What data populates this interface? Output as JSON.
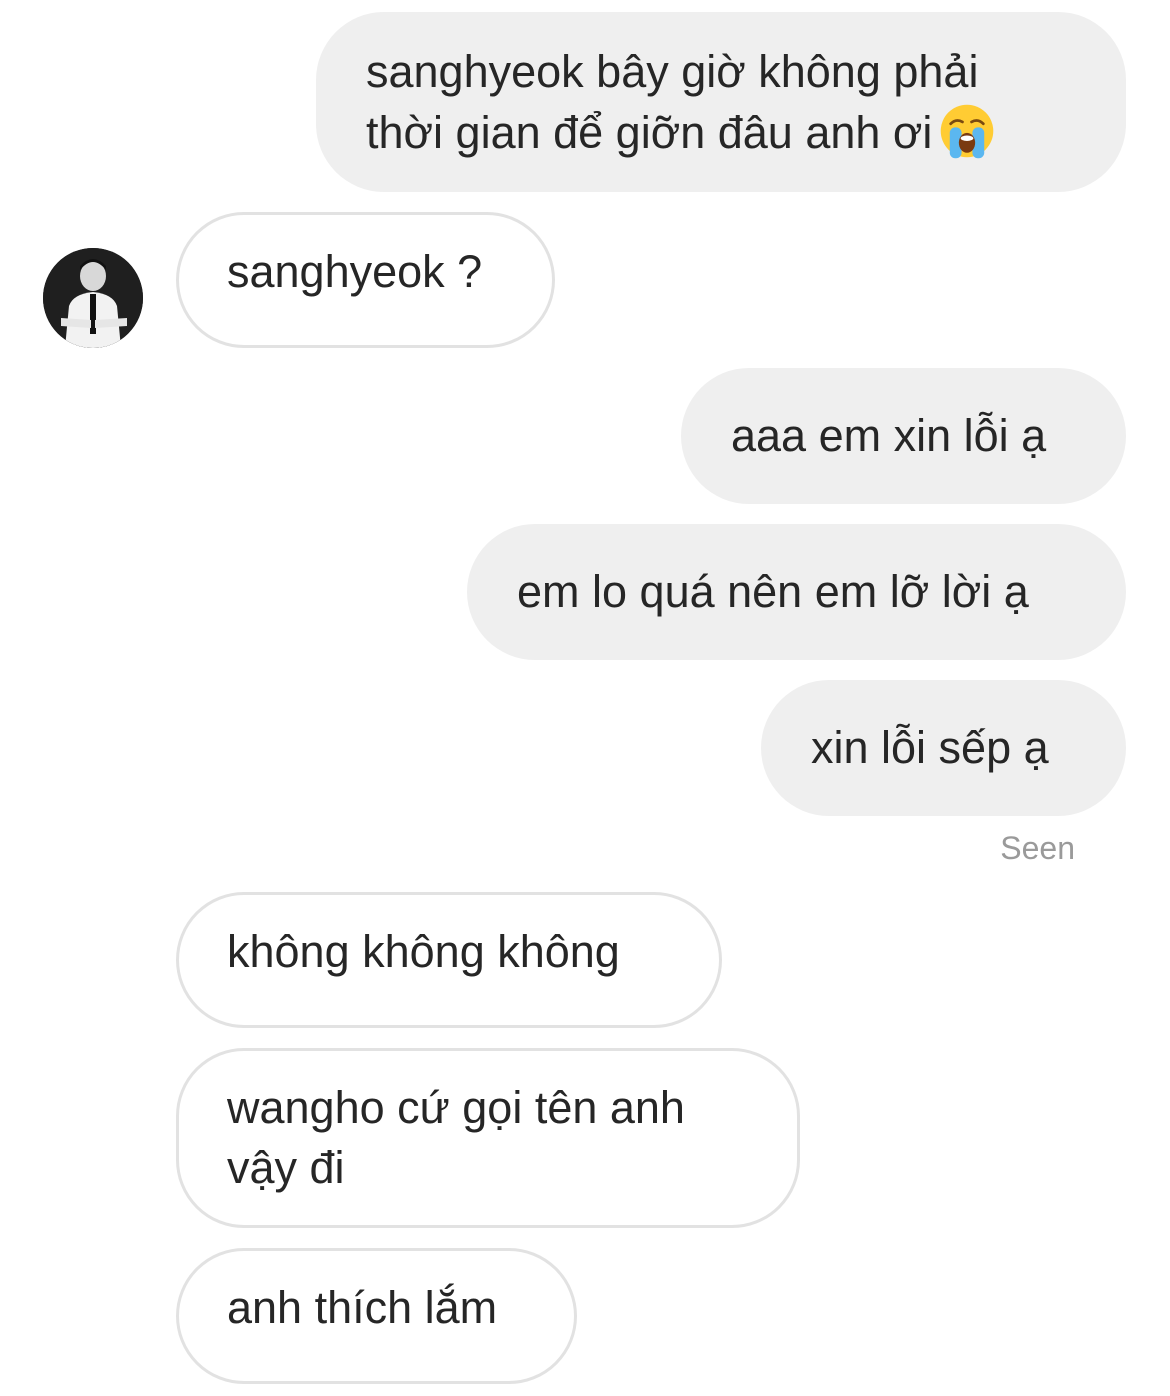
{
  "conversation": {
    "messages": [
      {
        "sender": "me",
        "lines": [
          "sanghyeok bây giờ không phải",
          "thời gian để giỡn đâu anh ơi"
        ],
        "emoji": "loudly-crying-face-icon"
      },
      {
        "sender": "them",
        "lines": [
          "sanghyeok ?"
        ]
      },
      {
        "sender": "me",
        "lines": [
          "aaa em xin lỗi ạ"
        ]
      },
      {
        "sender": "me",
        "lines": [
          "em lo quá nên em lỡ lời ạ"
        ]
      },
      {
        "sender": "me",
        "lines": [
          "xin lỗi sếp ạ"
        ]
      },
      {
        "sender": "them",
        "lines": [
          "không không không"
        ]
      },
      {
        "sender": "them",
        "lines": [
          "wangho cứ gọi tên anh",
          "vậy đi"
        ]
      },
      {
        "sender": "them",
        "lines": [
          "anh thích lắm"
        ]
      }
    ],
    "seen_label": "Seen"
  },
  "avatar": {
    "icon": "person-in-suit-photo"
  },
  "colors": {
    "outgoing_bubble": "#efefef",
    "incoming_border": "#e2e2e2",
    "text": "#262626",
    "seen_text": "#9a9a9a"
  }
}
